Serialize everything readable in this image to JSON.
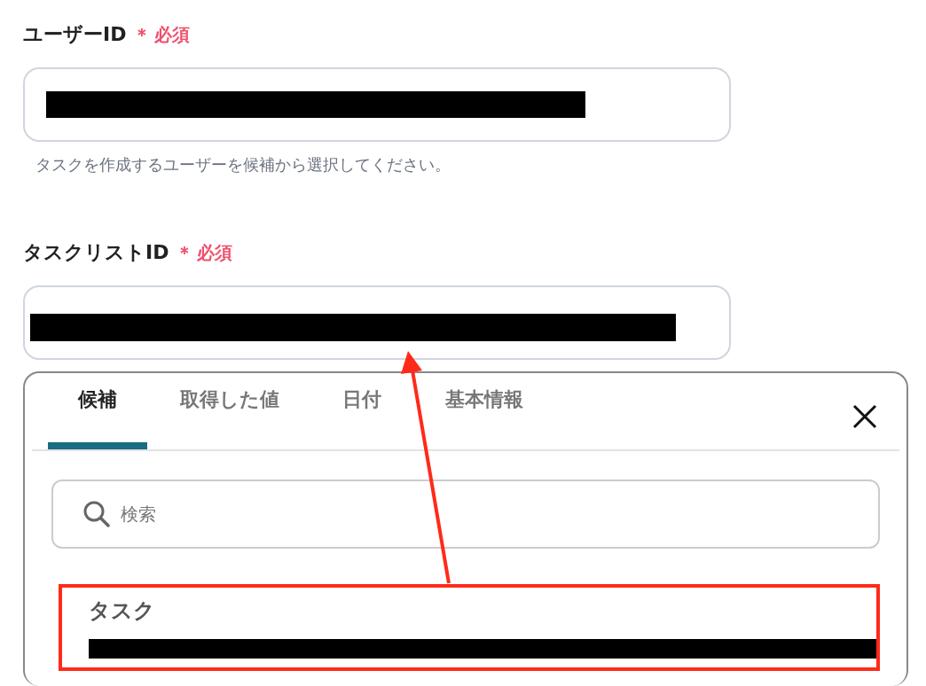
{
  "fields": [
    {
      "label": "ユーザーID",
      "required_mark": "＊",
      "required_label": "必須",
      "value_redacted": true,
      "help": "タスクを作成するユーザーを候補から選択してください。"
    },
    {
      "label": "タスクリストID",
      "required_mark": "＊",
      "required_label": "必須",
      "value_redacted": true
    }
  ],
  "picker": {
    "tabs": [
      {
        "label": "候補",
        "selected": true
      },
      {
        "label": "取得した値",
        "selected": false
      },
      {
        "label": "日付",
        "selected": false
      },
      {
        "label": "基本情報",
        "selected": false
      }
    ],
    "search": {
      "placeholder": "検索"
    },
    "options": [
      {
        "title": "タスク",
        "detail_redacted": true,
        "highlighted": true
      }
    ]
  }
}
